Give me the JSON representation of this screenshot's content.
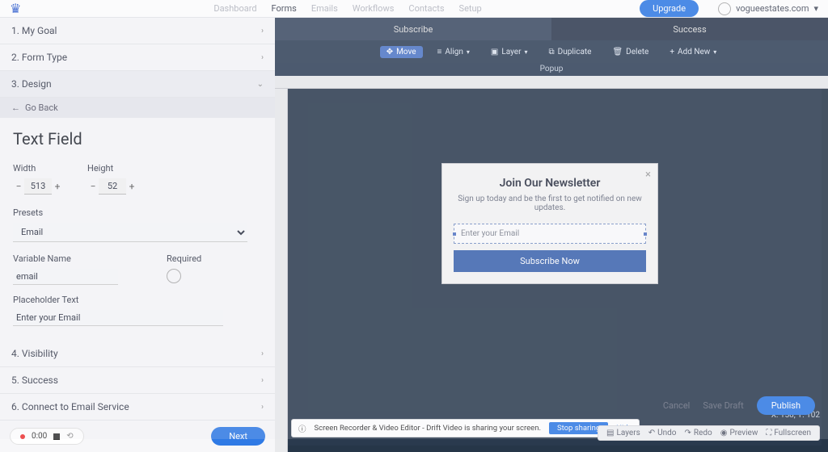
{
  "topnav": {
    "items": [
      "Dashboard",
      "Forms",
      "Emails",
      "Workflows",
      "Contacts",
      "Setup"
    ],
    "active_index": 1,
    "upgrade": "Upgrade",
    "site": "vogueestates.com"
  },
  "left": {
    "steps": [
      "1. My Goal",
      "2. Form Type",
      "3. Design",
      "4. Visibility",
      "5. Success",
      "6. Connect to Email Service"
    ],
    "go_back": "Go Back",
    "panel_title": "Text Field",
    "width_label": "Width",
    "width_value": "513",
    "height_label": "Height",
    "height_value": "52",
    "presets_label": "Presets",
    "preset_value": "Email",
    "varname_label": "Variable Name",
    "varname_value": "email",
    "required_label": "Required",
    "placeholder_label": "Placeholder Text",
    "placeholder_value": "Enter your Email",
    "rec_time": "0:00",
    "next": "Next"
  },
  "canvas": {
    "tabs": [
      "Subscribe",
      "Success"
    ],
    "tools": {
      "move": "Move",
      "align": "Align",
      "layer": "Layer",
      "duplicate": "Duplicate",
      "delete": "Delete",
      "addnew": "Add New"
    },
    "title_strip": "Popup",
    "popup": {
      "heading": "Join Our Newsletter",
      "sub": "Sign up today and be the first to get notified on new updates.",
      "field_placeholder": "Enter your Email",
      "cta": "Subscribe Now"
    },
    "coords": "X: 158, Y: 102",
    "bottom_tools": {
      "layers": "Layers",
      "undo": "Undo",
      "redo": "Redo",
      "preview": "Preview",
      "fullscreen": "Fullscreen"
    },
    "share": {
      "msg": "Screen Recorder & Video Editor - Drift Video is sharing your screen.",
      "stop": "Stop sharing",
      "hide": "Hide"
    }
  },
  "global": {
    "cancel": "Cancel",
    "save": "Save Draft",
    "publish": "Publish"
  }
}
